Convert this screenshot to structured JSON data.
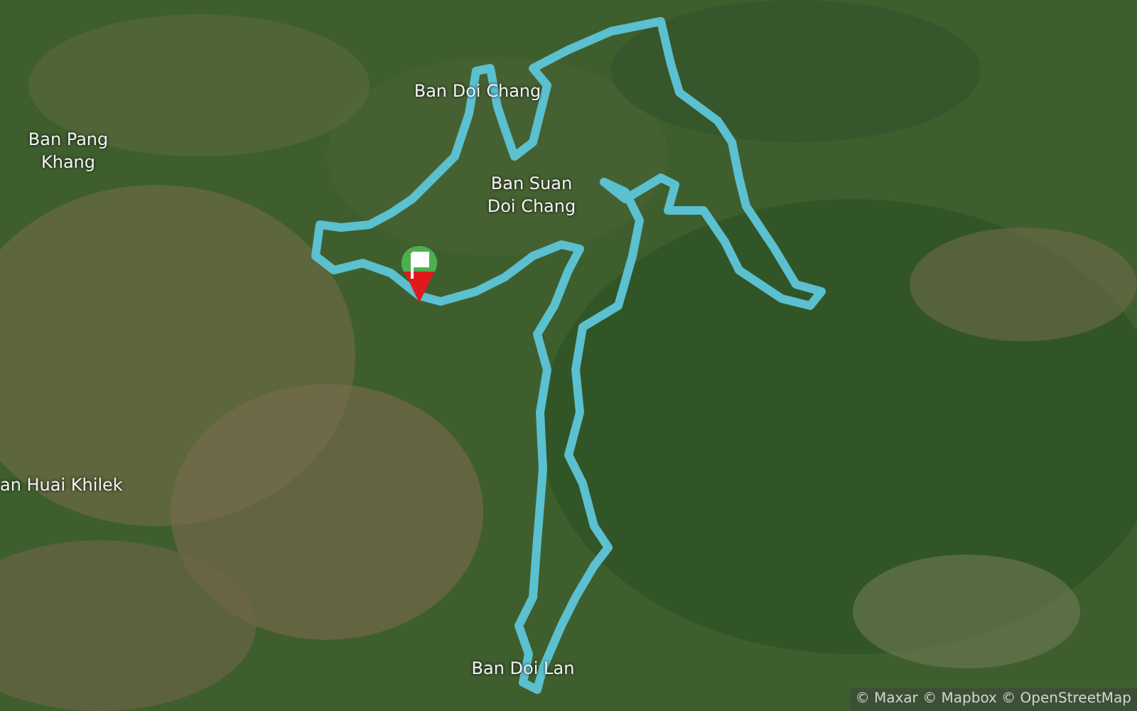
{
  "map": {
    "place_labels": [
      {
        "text": "Ban Doi Chang"
      },
      {
        "text": "Ban Pang Khang"
      },
      {
        "text": "Ban Suan Doi Chang"
      },
      {
        "text": "an Huai Khilek"
      },
      {
        "text": "Ban Doi Lan"
      }
    ],
    "route": {
      "color": "#5bc0d0"
    },
    "start_marker": {
      "kind": "flag"
    },
    "attribution": "© Maxar © Mapbox © OpenStreetMap"
  }
}
